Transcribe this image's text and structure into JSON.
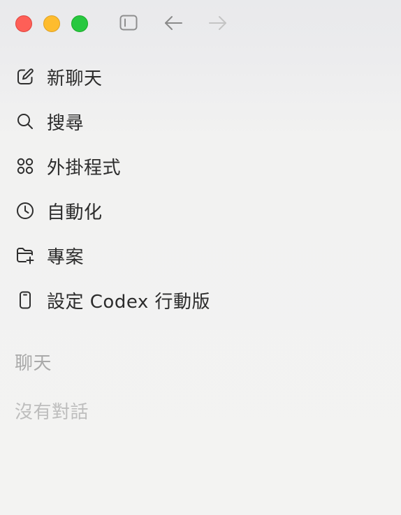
{
  "window": {
    "controls": {
      "close_color": "#fe5f57",
      "minimize_color": "#febc2e",
      "maximize_color": "#28c840"
    },
    "toolbar_icons": [
      "sidebar-toggle-icon",
      "arrow-left-icon",
      "arrow-right-icon"
    ]
  },
  "nav": {
    "items": [
      {
        "label": "新聊天",
        "icon": "compose-icon"
      },
      {
        "label": "搜尋",
        "icon": "search-icon"
      },
      {
        "label": "外掛程式",
        "icon": "plugins-grid-icon"
      },
      {
        "label": "自動化",
        "icon": "clock-icon"
      },
      {
        "label": "專案",
        "icon": "folder-add-icon"
      },
      {
        "label": "設定 Codex 行動版",
        "icon": "mobile-phone-icon"
      }
    ]
  },
  "chats": {
    "section_title": "聊天",
    "empty_text": "沒有對話"
  }
}
